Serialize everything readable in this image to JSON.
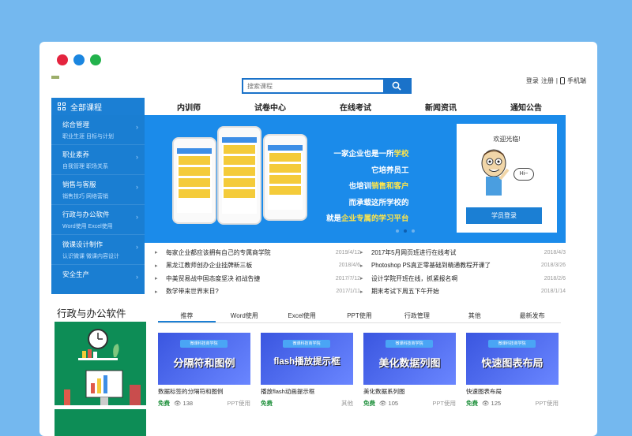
{
  "window": {
    "dots": [
      "#e4243e",
      "#1b86e0",
      "#22b24c"
    ]
  },
  "search": {
    "placeholder": "搜索课程"
  },
  "toplinks": {
    "login": "登录",
    "sep": "注册",
    "mobile": "手机端"
  },
  "allcat": {
    "label": "全部课程"
  },
  "nav": [
    "内训师",
    "试卷中心",
    "在线考试",
    "新闻资讯",
    "通知公告"
  ],
  "sidebar": [
    {
      "title": "综合管理",
      "sub": "职业生涯  目标与计划"
    },
    {
      "title": "职业素养",
      "sub": "自我管理  职场关系"
    },
    {
      "title": "销售与客服",
      "sub": "销售技巧  网络营销"
    },
    {
      "title": "行政与办公软件",
      "sub": "Word使用  Excel使用"
    },
    {
      "title": "微课设计制作",
      "sub": "认识微课  微课内容设计"
    },
    {
      "title": "安全生产",
      "sub": ""
    }
  ],
  "banner": {
    "lines": [
      {
        "a": "一家企业也是一所",
        "b": "学校"
      },
      {
        "a": "它培养员工",
        "b": ""
      },
      {
        "a": "也培训",
        "b": "销售和客户"
      },
      {
        "a": "而承载这所学校的",
        "b": ""
      },
      {
        "a": "就是",
        "b": "企业专属的学习平台"
      }
    ],
    "welcome": "欢迎光临!",
    "hi": "Hi~",
    "login_button": "学员登录"
  },
  "news_left": [
    {
      "title": "每家企业都应该拥有自己的专属商学院",
      "date": "2019/4/12"
    },
    {
      "title": "黑龙江教师创办企业挂牌新三板",
      "date": "2018/4/6"
    },
    {
      "title": "中美贸易战中国态度坚决 初战告捷",
      "date": "2017/7/12"
    },
    {
      "title": "数学带来世界末日?",
      "date": "2017/1/11"
    }
  ],
  "news_right": [
    {
      "title": "2017年5月网页班进行在线考试",
      "date": "2018/4/3"
    },
    {
      "title": "Photoshop PS真正零基础到精通教程开课了",
      "date": "2018/3/26"
    },
    {
      "title": "设计学院开班在线，抓紧报名啊",
      "date": "2018/2/6"
    },
    {
      "title": "期末考试下周五下午开始",
      "date": "2018/1/14"
    }
  ],
  "section": {
    "title": "行政与办公软件"
  },
  "tabs": [
    "推荐",
    "Word使用",
    "Excel使用",
    "PPT使用",
    "行政管理",
    "其他",
    "最新发布"
  ],
  "cards": [
    {
      "badge": "微课科技商学院",
      "cover": "分隔符和图例",
      "title": "数据标签的分隔符和图例",
      "free": "免费",
      "views": "138",
      "category": "PPT使用"
    },
    {
      "badge": "微课科技商学院",
      "cover": "flash播放提示框",
      "title": "播放flash动画提示框",
      "free": "免费",
      "views": "",
      "category": "其他"
    },
    {
      "badge": "微课科技商学院",
      "cover": "美化数据列图",
      "title": "美化数据系列图",
      "free": "免费",
      "views": "105",
      "category": "PPT使用"
    },
    {
      "badge": "微课科技商学院",
      "cover": "快速图表布局",
      "title": "快速图表布局",
      "free": "免费",
      "views": "125",
      "category": "PPT使用"
    }
  ]
}
